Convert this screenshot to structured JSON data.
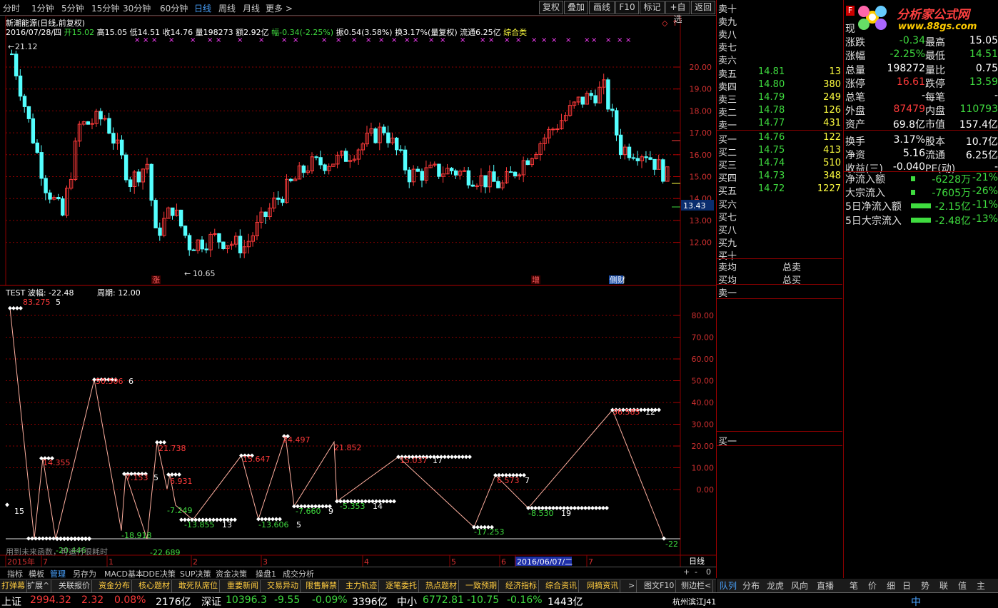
{
  "toolbar": {
    "timeframes": [
      "分时",
      "1分钟",
      "5分钟",
      "15分钟",
      "30分钟",
      "60分钟",
      "日线",
      "周线",
      "月线",
      "更多 >"
    ],
    "selected": "日线",
    "buttons": [
      "复权",
      "叠加",
      "画线",
      "F10",
      "标记",
      "+自选",
      "返回"
    ]
  },
  "stock": {
    "title": "新潮能源(日线,前复权)",
    "date": "2016/07/28/四",
    "open_label": "开",
    "open": "15.02",
    "high_label": "高",
    "high": "15.05",
    "low_label": "低",
    "low": "14.51",
    "close_label": "收",
    "close": "14.76",
    "volume_label": "量",
    "volume": "198273",
    "amount_label": "额",
    "amount": "2.92亿",
    "change_label": "幅",
    "change": "-0.34(-2.25%)",
    "amplitude": "振0.54(3.58%)",
    "turnover": "换3.17%(量复权)",
    "float": "流通6.25亿",
    "category": "综合类"
  },
  "price_chart": {
    "y_ticks": [
      "20.00",
      "19.00",
      "18.00",
      "17.00",
      "16.00",
      "15.00",
      "14.00",
      "13.00",
      "12.00"
    ],
    "max_label": "21.12",
    "min_label": "10.65",
    "current_price_tag": "13.43",
    "markers": [
      "涨",
      "增",
      "侧财"
    ]
  },
  "indicator": {
    "name": "TEST",
    "param1": "波幅: -22.48",
    "param2": "周期: 12.00",
    "y_ticks": [
      "80.00",
      "70.00",
      "60.00",
      "50.00",
      "40.00",
      "30.00",
      "20.00",
      "10.00",
      "0.00"
    ],
    "note": "用到未来函数，可运行很耗时",
    "labels": [
      {
        "text": "83.275",
        "n": "5"
      },
      {
        "text": "15",
        "n": ""
      },
      {
        "text": "14.355",
        "n": ""
      },
      {
        "text": "-20.446",
        "n": ""
      },
      {
        "text": "50.506",
        "n": "6"
      },
      {
        "text": "7.153",
        "n": "5"
      },
      {
        "text": "-18.918",
        "n": ""
      },
      {
        "text": "-22.689",
        "n": ""
      },
      {
        "text": "21.738",
        "n": ""
      },
      {
        "text": "6.931",
        "n": ""
      },
      {
        "text": "-7.249",
        "n": ""
      },
      {
        "text": "-13.855",
        "n": "13"
      },
      {
        "text": "15.647",
        "n": ""
      },
      {
        "text": "-13.606",
        "n": "5"
      },
      {
        "text": "24.497",
        "n": ""
      },
      {
        "text": "-7.660",
        "n": "9"
      },
      {
        "text": "21.852",
        "n": ""
      },
      {
        "text": "-5.353",
        "n": "14"
      },
      {
        "text": "15.037",
        "n": "17"
      },
      {
        "text": "-17.253",
        "n": ""
      },
      {
        "text": "6.573",
        "n": "7"
      },
      {
        "text": "-8.530",
        "n": "19"
      },
      {
        "text": "36.585",
        "n": "12"
      },
      {
        "text": "-22",
        "n": ""
      }
    ],
    "x_axis": [
      "2015年",
      "7",
      "1",
      "2",
      "3",
      "4",
      "5",
      "6",
      "2016/06/07/二",
      "7"
    ],
    "period": "日线",
    "zoom_buttons": [
      "+",
      "-",
      "0"
    ]
  },
  "bottom_tabs": [
    "指标",
    "模板",
    "管理",
    "另存为",
    "MACD基本",
    "DDE决策",
    "SUP决策",
    "资金决策",
    "操盘1",
    "成交分析"
  ],
  "news_tabs": [
    "打弹幕",
    "扩展^",
    "关联报价",
    "资金分布",
    "核心题材",
    "敢死队席位",
    "重要新闻",
    "交易异动",
    "限售解禁",
    "主力轨迹",
    "逐笔委托",
    "热点题材",
    "一致预期",
    "经济指标",
    "综合资讯",
    "网摘资讯",
    ">",
    "图文F10",
    "侧边栏<"
  ],
  "order_book": {
    "sells": [
      {
        "label": "卖十",
        "price": "",
        "vol": ""
      },
      {
        "label": "卖九",
        "price": "",
        "vol": ""
      },
      {
        "label": "卖八",
        "price": "",
        "vol": ""
      },
      {
        "label": "卖七",
        "price": "",
        "vol": ""
      },
      {
        "label": "卖六",
        "price": "",
        "vol": ""
      },
      {
        "label": "卖五",
        "price": "14.81",
        "vol": "13"
      },
      {
        "label": "卖四",
        "price": "14.80",
        "vol": "380"
      },
      {
        "label": "卖三",
        "price": "14.79",
        "vol": "249"
      },
      {
        "label": "卖二",
        "price": "14.78",
        "vol": "126"
      },
      {
        "label": "卖一",
        "price": "14.77",
        "vol": "431"
      }
    ],
    "buys": [
      {
        "label": "买一",
        "price": "14.76",
        "vol": "122"
      },
      {
        "label": "买二",
        "price": "14.75",
        "vol": "413"
      },
      {
        "label": "买三",
        "price": "14.74",
        "vol": "510"
      },
      {
        "label": "买四",
        "price": "14.73",
        "vol": "348"
      },
      {
        "label": "买五",
        "price": "14.72",
        "vol": "1227"
      },
      {
        "label": "买六",
        "price": "",
        "vol": ""
      },
      {
        "label": "买七",
        "price": "",
        "vol": ""
      },
      {
        "label": "买八",
        "price": "",
        "vol": ""
      },
      {
        "label": "买九",
        "price": "",
        "vol": ""
      },
      {
        "label": "买十",
        "price": "",
        "vol": ""
      }
    ],
    "avg_sell": "卖均",
    "total_sell": "总卖",
    "avg_buy": "买均",
    "total_buy": "总买",
    "tick_sell": "卖一",
    "tick_buy": "买一"
  },
  "quote": {
    "logo_text": "分析家公式网",
    "logo_url": "www.88gs.com",
    "rows": [
      {
        "l1": "现",
        "v1": "",
        "l2": "",
        "v2": ""
      },
      {
        "l1": "涨跌",
        "v1": "-0.34",
        "l2": "最高",
        "v2": "15.05"
      },
      {
        "l1": "涨幅",
        "v1": "-2.25%",
        "l2": "最低",
        "v2": "14.51"
      },
      {
        "l1": "总量",
        "v1": "198272",
        "l2": "量比",
        "v2": "0.75"
      },
      {
        "l1": "涨停",
        "v1": "16.61",
        "l2": "跌停",
        "v2": "13.59"
      },
      {
        "l1": "总笔",
        "v1": "-",
        "l2": "每笔",
        "v2": "-"
      },
      {
        "l1": "外盘",
        "v1": "87479",
        "l2": "内盘",
        "v2": "110793"
      },
      {
        "l1": "资产",
        "v1": "69.8亿",
        "l2": "市值",
        "v2": "157.4亿"
      },
      {
        "l1": "换手",
        "v1": "3.17%",
        "l2": "股本",
        "v2": "10.7亿"
      },
      {
        "l1": "净资",
        "v1": "5.16",
        "l2": "流通",
        "v2": "6.25亿"
      },
      {
        "l1": "收益(三)",
        "v1": "-0.040",
        "l2": "PE(动)",
        "v2": "-"
      }
    ],
    "flows": [
      {
        "label": "净流入额",
        "value": "-6228万",
        "pct": "-21%"
      },
      {
        "label": "大宗流入",
        "value": "-7605万",
        "pct": "-26%"
      },
      {
        "label": "5日净流入额",
        "value": "-2.15亿",
        "pct": "-11%"
      },
      {
        "label": "5日大宗流入",
        "value": "-2.48亿",
        "pct": "-13%"
      }
    ]
  },
  "right_tabs": [
    "队列",
    "分布",
    "龙虎",
    "风向",
    "直播",
    "笔",
    "价",
    "细",
    "日",
    "势",
    "联",
    "值",
    "主"
  ],
  "status": {
    "sh_name": "上证",
    "sh_val": "2994.32",
    "sh_chg": "2.32",
    "sh_pct": "0.08%",
    "sh_amt": "2176亿",
    "sz_name": "深证",
    "sz_val": "10396.3",
    "sz_chg": "-9.55",
    "sz_pct": "-0.09%",
    "sz_amt": "3396亿",
    "zx_name": "中小",
    "zx_val": "6772.81",
    "zx_chg": "-10.75",
    "zx_pct": "-0.16%",
    "zx_amt": "1443亿",
    "server": "杭州滨江J41",
    "ime": "中"
  },
  "colors": {
    "up": "#ff3a3a",
    "down": "#54ffff",
    "grid": "#8b0000"
  }
}
